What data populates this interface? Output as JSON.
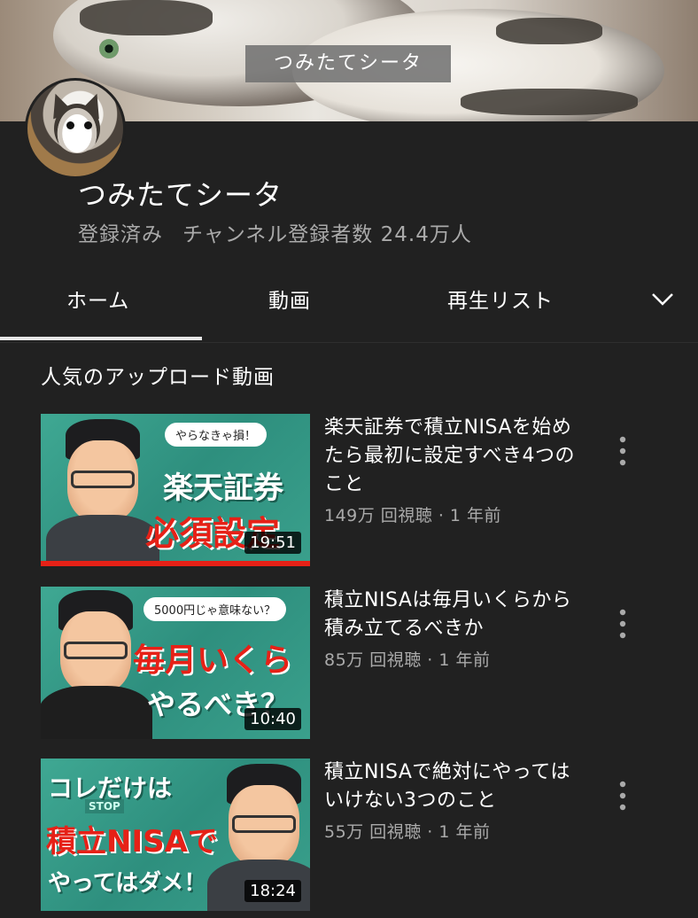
{
  "banner": {
    "label": "つみたてシータ"
  },
  "channel": {
    "name": "つみたてシータ",
    "subscribed_status": "登録済み",
    "subscriber_text": "チャンネル登録者数 24.4万人"
  },
  "tabs": [
    {
      "label": "ホーム",
      "selected": true
    },
    {
      "label": "動画"
    },
    {
      "label": "再生リスト"
    }
  ],
  "section": {
    "title": "人気のアップロード動画"
  },
  "videos": [
    {
      "title": "楽天証券で積立NISAを始めたら最初に設定すべき4つのこと",
      "meta": "149万 回視聴 · 1 年前",
      "duration": "19:51",
      "thumb_tag": "やらなきゃ損！",
      "thumb_line1": "楽天証券",
      "thumb_line2": "必須設定",
      "watched_fraction": 1.0
    },
    {
      "title": "積立NISAは毎月いくらから積み立てるべきか",
      "meta": "85万 回視聴 · 1 年前",
      "duration": "10:40",
      "thumb_tag": "5000円じゃ意味ない？",
      "thumb_line1": "毎月いくら",
      "thumb_line2": "やるべき？"
    },
    {
      "title": "積立NISAで絶対にやってはいけない3つのこと",
      "meta": "55万 回視聴 · 1 年前",
      "duration": "18:24",
      "thumb_line1": "コレだけは",
      "thumb_line2": "積立NISAで",
      "thumb_line3": "やってはダメ！",
      "thumb_sign": "STOP"
    }
  ],
  "colors": {
    "background": "#212121",
    "accent_red": "#e62117",
    "secondary_text": "#aaaaaa"
  }
}
